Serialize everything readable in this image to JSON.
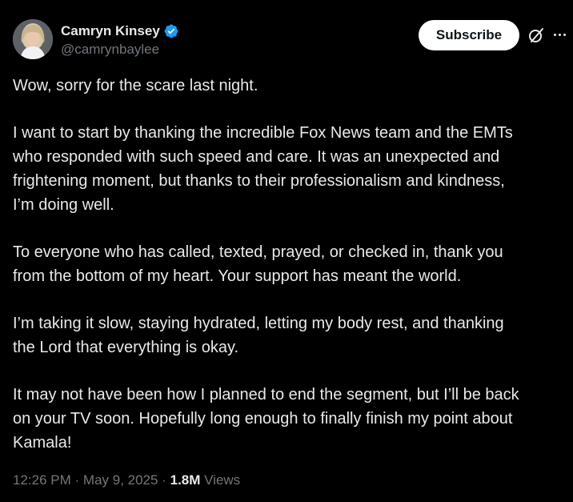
{
  "author": {
    "display_name": "Camryn Kinsey",
    "handle": "@camrynbaylee",
    "verified": true,
    "verified_color": "#1d9bf0"
  },
  "actions": {
    "subscribe_label": "Subscribe",
    "grok_icon": "grok-slash-icon",
    "more_icon": "more-horizontal-icon"
  },
  "post": {
    "paragraphs": [
      "Wow, sorry for the scare last night.",
      "I want to start by thanking the incredible Fox News team and the EMTs\nwho responded with such speed and care. It was an unexpected and\nfrightening moment, but thanks to their professionalism and kindness,\nI’m doing well.",
      "To everyone who has called, texted, prayed, or checked in, thank you\nfrom the bottom of my heart. Your support has meant the world.",
      "I’m taking it slow, staying hydrated, letting my body rest, and thanking\nthe Lord that everything is okay.",
      "It may not have been how I planned to end the segment, but I’ll be back\non your TV soon. Hopefully long enough to finally finish my point about\nKamala!"
    ]
  },
  "meta": {
    "time": "12:26 PM",
    "separator": "·",
    "date": "May 9, 2025",
    "views_count": "1.8M",
    "views_label": "Views"
  },
  "colors": {
    "background": "#000000",
    "text_primary": "#e7e9ea",
    "text_secondary": "#71767b",
    "button_bg": "#ffffff"
  }
}
